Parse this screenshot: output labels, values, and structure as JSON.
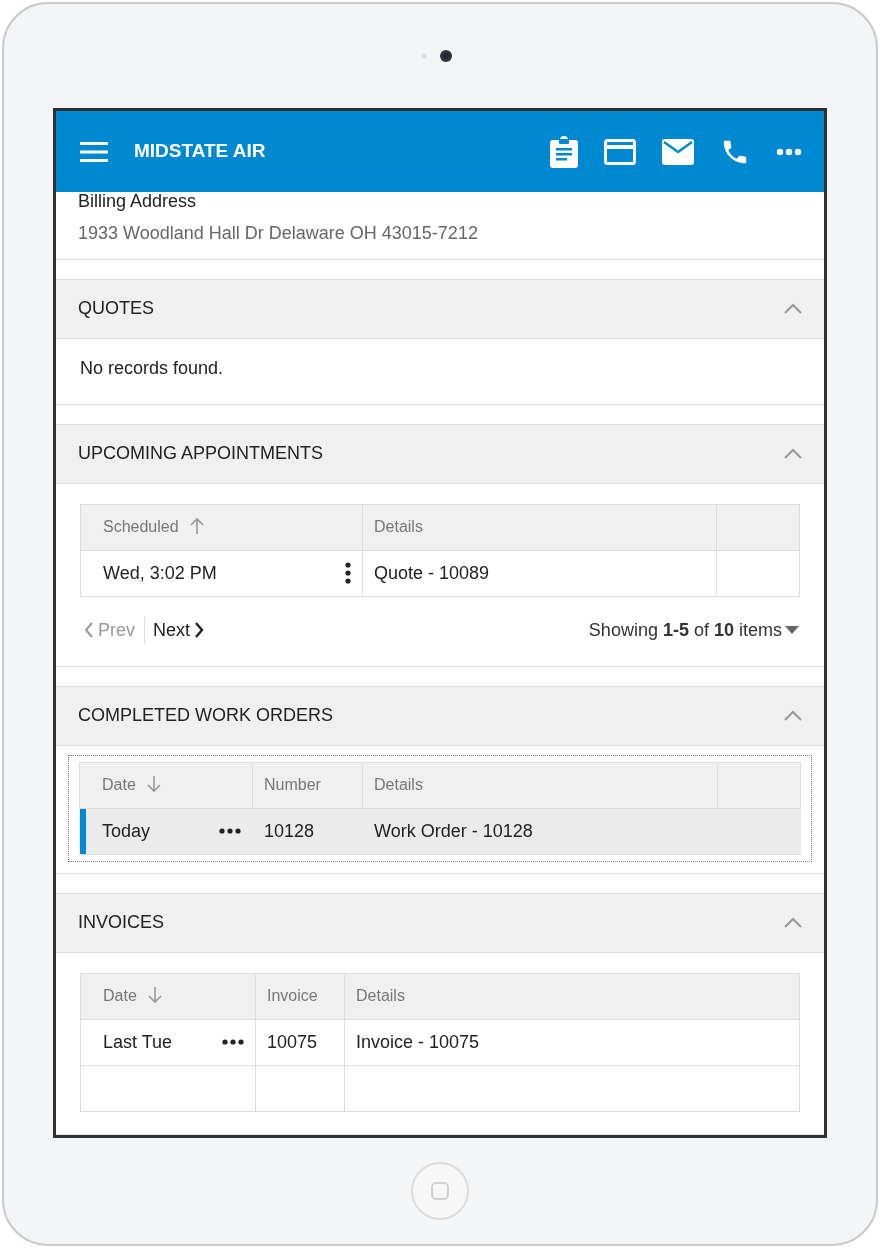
{
  "app_bar": {
    "title": "MIDSTATE AIR",
    "actions": [
      {
        "kind": "clipboard"
      },
      {
        "kind": "card"
      },
      {
        "kind": "mail"
      },
      {
        "kind": "phone"
      },
      {
        "kind": "more"
      }
    ]
  },
  "billing": {
    "label": "Billing Address",
    "value": "1933 Woodland Hall Dr Delaware OH 43015-7212"
  },
  "sections": [
    {
      "title": "QUOTES",
      "expanded": true,
      "kind": "message",
      "message": "No records found."
    },
    {
      "title": "UPCOMING APPOINTMENTS",
      "expanded": true,
      "kind": "grid",
      "focused": false,
      "spacer_column": true,
      "trailing_blank_row": false,
      "columns": [
        {
          "label": "Scheduled",
          "kind": "ascending"
        },
        {
          "label": "Details",
          "kind": "plain"
        }
      ],
      "rows": [
        {
          "cells": [
            "Wed, 3:02 PM",
            "Quote - 10089"
          ],
          "kind": "vertical",
          "selected": false
        }
      ],
      "pager": {
        "prev": "Prev",
        "next": "Next",
        "showing": "Showing **1-5** of **10** items"
      }
    },
    {
      "title": "COMPLETED WORK ORDERS",
      "expanded": true,
      "kind": "grid",
      "focused": true,
      "spacer_column": true,
      "trailing_blank_row": false,
      "columns": [
        {
          "label": "Date",
          "kind": "descending"
        },
        {
          "label": "Number",
          "kind": "plain"
        },
        {
          "label": "Details",
          "kind": "plain"
        }
      ],
      "rows": [
        {
          "cells": [
            "Today",
            "10128",
            "Work Order - 10128"
          ],
          "kind": "horizontal",
          "selected": true
        }
      ]
    },
    {
      "title": "INVOICES",
      "expanded": true,
      "kind": "grid",
      "focused": false,
      "spacer_column": false,
      "trailing_blank_row": true,
      "columns": [
        {
          "label": "Date",
          "kind": "descending"
        },
        {
          "label": "Invoice",
          "kind": "plain"
        },
        {
          "label": "Details",
          "kind": "plain"
        }
      ],
      "rows": [
        {
          "cells": [
            "Last Tue",
            "10075",
            "Invoice - 10075"
          ],
          "kind": "horizontal",
          "selected": false
        }
      ]
    }
  ]
}
